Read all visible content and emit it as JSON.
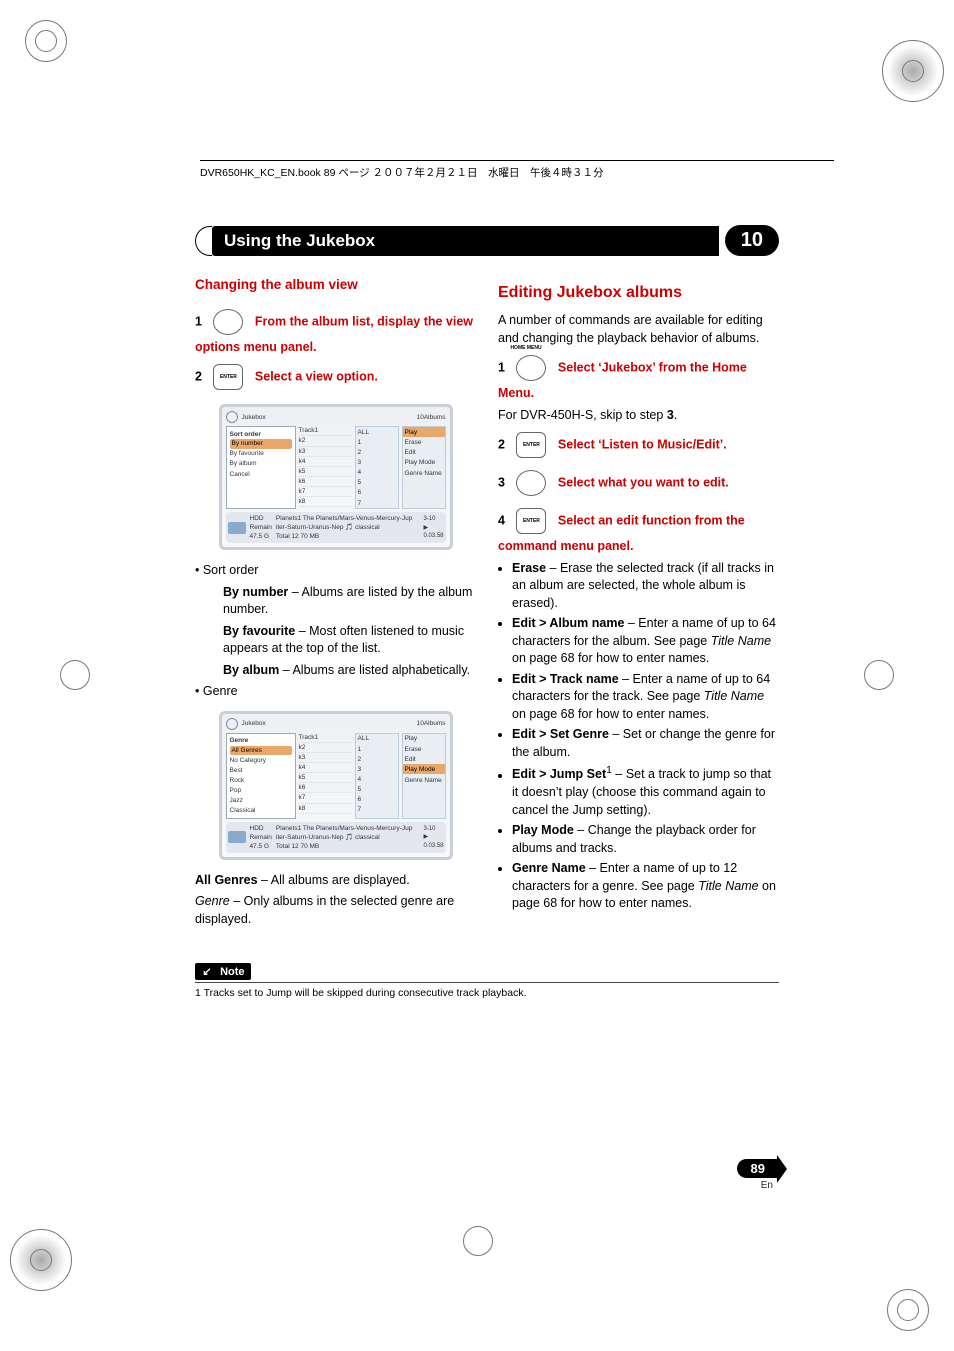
{
  "header": {
    "filename_line": "DVR650HK_KC_EN.book  89 ページ  ２００７年２月２１日　水曜日　午後４時３１分"
  },
  "chapter": {
    "title": "Using the Jukebox",
    "number": "10"
  },
  "left": {
    "h_change": "Changing the album view",
    "step1": {
      "n": "1",
      "txt": "From the album list, display the view options menu panel."
    },
    "step2": {
      "n": "2",
      "txt": "Select a view option."
    },
    "shot1": {
      "top": "Jukebox",
      "count": "10Albums",
      "menu_head": "Sort order",
      "menu_items": [
        "By number",
        "By favourite",
        "By album",
        "",
        "Cancel"
      ],
      "menu_sel": "By number",
      "tracks_head": "Track1",
      "side_top": "ALL",
      "side_nums": [
        "1",
        "2",
        "3",
        "4",
        "5",
        "6",
        "7"
      ],
      "side_cmds": [
        "Play",
        "Erase",
        "Edit",
        "Play Mode",
        "",
        "Genre Name"
      ],
      "foot_title": "Planets1  The Planets/Mars-Venus-Mercury-Jup",
      "foot_sub": "iter-Saturn-Uranus-Nep        🎵 classical",
      "foot_total": "Total 12       70 MB",
      "hdd": "HDD",
      "remain": "Remain",
      "remain_v": "47.5 G",
      "pos": "3-10",
      "time": "0.03.58"
    },
    "sort_head": "• Sort order",
    "sort_items": [
      {
        "b": "By number",
        "t": " – Albums are listed by the album number."
      },
      {
        "b": "By favourite",
        "t": " – Most often listened to music appears at the top of the list."
      },
      {
        "b": "By album",
        "t": " – Albums are listed alphabetically."
      }
    ],
    "genre_head": "• Genre",
    "shot2": {
      "menu_head": "Genre",
      "menu_items": [
        "All Genres",
        "No Category",
        "Best",
        "Rock",
        "Pop",
        "Jazz",
        "Classical"
      ],
      "menu_sel": "All Genres"
    },
    "allgenres_b": "All Genres",
    "allgenres_t": " – All albums are displayed.",
    "genre_i": "Genre",
    "genre_t": " – Only albums in the selected genre are displayed."
  },
  "right": {
    "h_edit": "Editing Jukebox albums",
    "intro": "A number of commands are available for editing and changing the playback behavior of albums.",
    "step1": {
      "n": "1",
      "txt": "Select ‘Jukebox’ from the Home Menu."
    },
    "skip": "For DVR-450H-S, skip to step ",
    "skip_b": "3",
    "skip_dot": ".",
    "step2": {
      "n": "2",
      "txt": "Select ‘Listen to Music/Edit’."
    },
    "step3": {
      "n": "3",
      "txt": "Select what you want to edit."
    },
    "step4": {
      "n": "4",
      "txt": "Select an edit function from the command menu panel."
    },
    "bullets": [
      {
        "b": "Erase",
        "t": " – Erase the selected track (if all tracks in an album are selected, the whole album is erased)."
      },
      {
        "b": "Edit > Album name",
        "t": " – Enter a name of up to 64 characters for the album. See page ",
        "i": "Title Name",
        "t2": " on page 68 for how to enter names."
      },
      {
        "b": "Edit > Track name",
        "t": " – Enter a name of up to 64 characters for the track. See page ",
        "i": "Title Name",
        "t2": " on page 68 for how to enter names."
      },
      {
        "b": "Edit > Set Genre",
        "t": " – Set or change the genre for the album."
      },
      {
        "b": "Edit > Jump Set",
        "sup": "1",
        "t": " – Set a track to jump so that it doesn’t play (choose this command again to cancel the Jump setting)."
      },
      {
        "b": "Play Mode",
        "t": " – Change the playback order for albums and tracks."
      },
      {
        "b": "Genre Name",
        "t": " – Enter a name of up to 12 characters for a genre. See page ",
        "i": "Title Name",
        "t2": " on page 68 for how to enter names."
      }
    ]
  },
  "note": {
    "flag": "Note",
    "text": "1 Tracks set to Jump will be skipped during consecutive track playback."
  },
  "page": {
    "num": "89",
    "lang": "En"
  }
}
